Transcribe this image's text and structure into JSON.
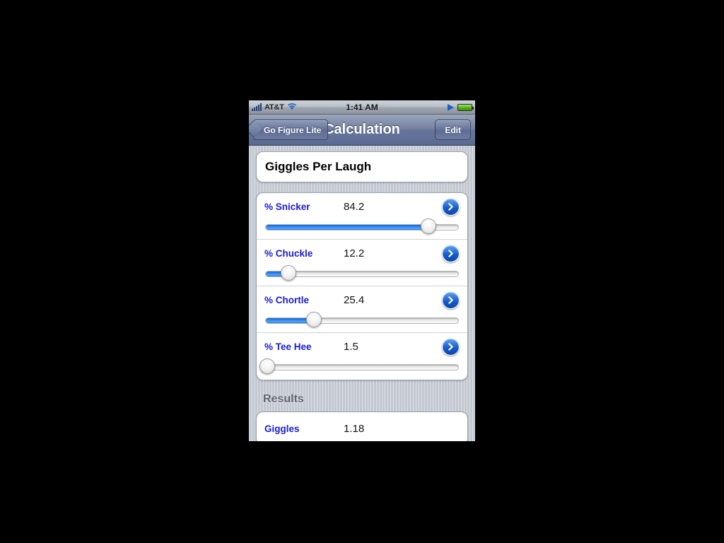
{
  "status_bar": {
    "carrier": "AT&T",
    "time": "1:41 AM",
    "signal_icon": "signal-bars-icon",
    "wifi_icon": "wifi-icon",
    "play_icon": "play-icon",
    "battery_icon": "battery-icon"
  },
  "nav_bar": {
    "back_label": "Go Figure Lite",
    "title": "Calculation",
    "edit_label": "Edit"
  },
  "calculation": {
    "title": "Giggles Per Laugh"
  },
  "inputs": [
    {
      "label": "% Snicker",
      "value": "84.2",
      "percent": 84.2,
      "disclosure_icon": "chevron-right-icon"
    },
    {
      "label": "% Chuckle",
      "value": "12.2",
      "percent": 12.2,
      "disclosure_icon": "chevron-right-icon"
    },
    {
      "label": "% Chortle",
      "value": "25.4",
      "percent": 25.4,
      "disclosure_icon": "chevron-right-icon"
    },
    {
      "label": "% Tee Hee",
      "value": "1.5",
      "percent": 1.5,
      "disclosure_icon": "chevron-right-icon"
    }
  ],
  "results_section": {
    "header": "Results",
    "rows": [
      {
        "label": "Giggles",
        "value": "1.18"
      }
    ]
  },
  "colors": {
    "accent_blue": "#1a1ad6",
    "slider_fill": "#2b84ef",
    "nav_bar": "#6e7ca0",
    "background": "#c3c8d1",
    "battery_green": "#4fb216"
  }
}
